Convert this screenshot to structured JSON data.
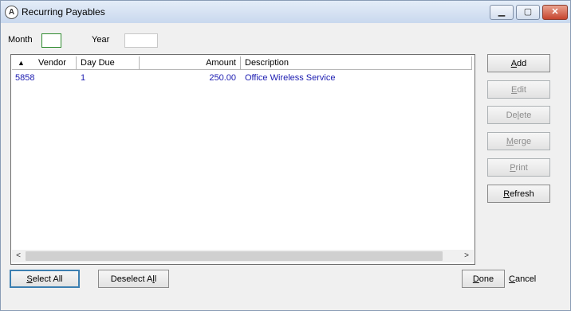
{
  "window": {
    "title": "Recurring Payables",
    "icon_label": "A"
  },
  "filters": {
    "month_label": "Month",
    "month_value": "",
    "year_label": "Year",
    "year_value": ""
  },
  "grid": {
    "columns": [
      {
        "label": "Vendor"
      },
      {
        "label": "Day Due"
      },
      {
        "label": "Amount"
      },
      {
        "label": "Description"
      }
    ],
    "rows": [
      {
        "vendor": "5858",
        "day_due": "1",
        "amount": "250.00",
        "description": "Office Wireless Service"
      }
    ],
    "cell_color": "#1a1ab0"
  },
  "side_buttons": {
    "add_pre": "",
    "add_u": "A",
    "add_post": "dd",
    "edit_pre": "",
    "edit_u": "E",
    "edit_post": "dit",
    "delete_pre": "De",
    "delete_u": "l",
    "delete_post": "ete",
    "merge_pre": "",
    "merge_u": "M",
    "merge_post": "erge",
    "print_pre": "",
    "print_u": "P",
    "print_post": "rint",
    "refresh_pre": "",
    "refresh_u": "R",
    "refresh_post": "efresh"
  },
  "bottom": {
    "select_all_pre": "",
    "select_all_u": "S",
    "select_all_post": "elect All",
    "deselect_all_pre": "Deselect A",
    "deselect_all_u": "l",
    "deselect_all_post": "l",
    "done_pre": "",
    "done_u": "D",
    "done_post": "one",
    "cancel_pre": "",
    "cancel_u": "C",
    "cancel_post": "ancel"
  },
  "icons": {
    "minimize": "minimize-icon",
    "maximize": "maximize-icon",
    "close": "close-icon",
    "sort": "sort-ascending-icon"
  }
}
